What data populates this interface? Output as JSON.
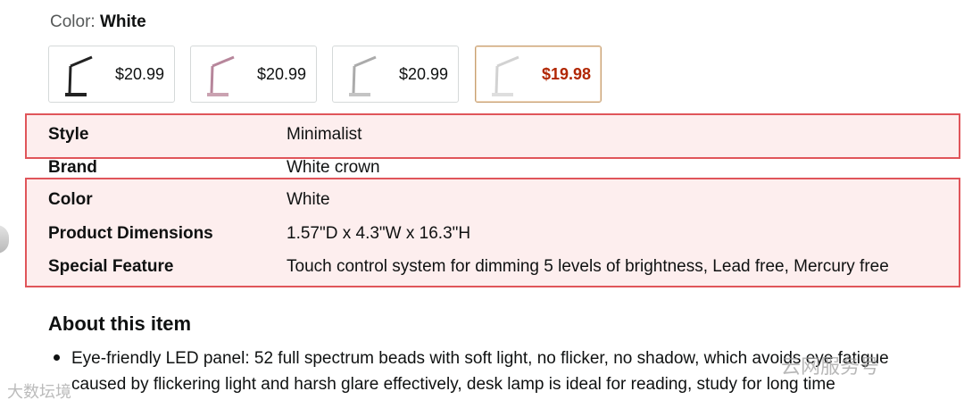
{
  "color_selector": {
    "label": "Color:",
    "value": "White",
    "swatches": [
      {
        "price": "$20.99",
        "icon": "black-desk-lamp-thumbnail"
      },
      {
        "price": "$20.99",
        "icon": "rose-desk-lamp-thumbnail"
      },
      {
        "price": "$20.99",
        "icon": "silver-desk-lamp-thumbnail"
      },
      {
        "price": "$19.98",
        "icon": "white-desk-lamp-thumbnail",
        "selected": true
      }
    ]
  },
  "specs": [
    {
      "key": "Style",
      "value": "Minimalist"
    },
    {
      "key": "Brand",
      "value": "White crown"
    },
    {
      "key": "Color",
      "value": "White"
    },
    {
      "key": "Product Dimensions",
      "value": "1.57\"D x 4.3\"W x 16.3\"H"
    },
    {
      "key": "Special Feature",
      "value": "Touch control system for dimming 5 levels of brightness, Lead free, Mercury free"
    }
  ],
  "about": {
    "title": "About this item",
    "bullets": [
      "Eye-friendly LED panel: 52 full spectrum beads with soft light, no flicker, no shadow, which avoids eye fatigue caused by flickering light and harsh glare effectively, desk lamp is ideal for reading, study for long time"
    ]
  },
  "watermarks": {
    "right": "云网服务号",
    "left": "大数坛境"
  },
  "colors": {
    "highlight_border": "#e0555a",
    "highlight_fill": "#fdeeee",
    "selected_price": "#b12704",
    "selected_border": "#c7a074"
  }
}
